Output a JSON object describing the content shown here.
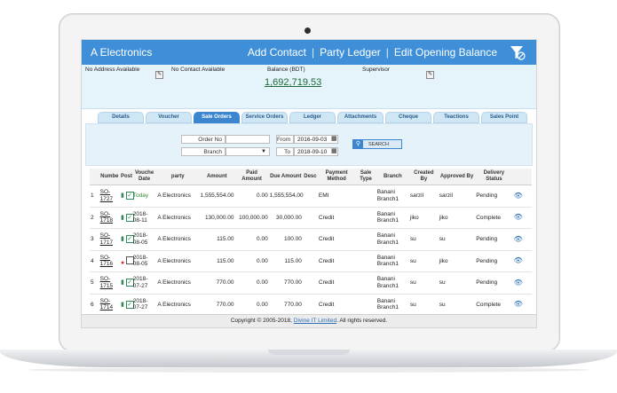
{
  "app": {
    "title": "A Electronics"
  },
  "top_actions": {
    "add_contact": "Add Contact",
    "party_ledger": "Party Ledger",
    "edit_opening_balance": "Edit Opening Balance",
    "sep": "|"
  },
  "info": {
    "address": "No Address Available",
    "contact": "No Contact Available",
    "balance_label": "Balance (BDT)",
    "balance_value": "1,692,719.53",
    "supervisor_label": "Supervisor"
  },
  "tabs": [
    "Details",
    "Voucher",
    "Sale Orders",
    "Service Orders",
    "Ledger",
    "Attachments",
    "Cheque",
    "Teactions",
    "Sales Point"
  ],
  "filters": {
    "order_no_label": "Order No",
    "branch_label": "Branch",
    "from_label": "From",
    "from_value": "2016-09-03",
    "to_label": "To",
    "to_value": "2018-09-10",
    "search_label": "SEARCH"
  },
  "table": {
    "headers": [
      "",
      "Numbe",
      "Post",
      "Vouche Date",
      "party",
      "Amount",
      "Paid Amount",
      "Due Amount",
      "Desc",
      "Payment Method",
      "Sale Type",
      "Branch",
      "Created By",
      "Approved By",
      "Delivery Status",
      ""
    ],
    "rows": [
      {
        "idx": "1",
        "no": "SO-1727",
        "post": "green",
        "checked": true,
        "date": "Today",
        "party": "A Electronics",
        "amount": "1,555,554.00",
        "paid": "0.00",
        "due": "1,555,554.00",
        "desc": "",
        "method": "EMI",
        "sale_type": "",
        "branch": "Banani Branch1",
        "created": "sarzil",
        "approved": "sarzil",
        "status": "Pending"
      },
      {
        "idx": "2",
        "no": "SO-1718",
        "post": "green",
        "checked": true,
        "date": "2018-08-11",
        "party": "A Electronics",
        "amount": "130,000.00",
        "paid": "100,000.00",
        "due": "30,000.00",
        "desc": "",
        "method": "Credit",
        "sale_type": "",
        "branch": "Banani Branch1",
        "created": "jiko",
        "approved": "jiko",
        "status": "Complete"
      },
      {
        "idx": "3",
        "no": "SO-1717",
        "post": "green",
        "checked": true,
        "date": "2018-08-05",
        "party": "A Electronics",
        "amount": "115.00",
        "paid": "0.00",
        "due": "100.00",
        "desc": "",
        "method": "Credit",
        "sale_type": "",
        "branch": "Banani Branch1",
        "created": "su",
        "approved": "su",
        "status": "Pending"
      },
      {
        "idx": "4",
        "no": "SO-1716",
        "post": "red",
        "checked": false,
        "date": "2018-08-05",
        "party": "A Electronics",
        "amount": "115.00",
        "paid": "0.00",
        "due": "115.00",
        "desc": "",
        "method": "Credit",
        "sale_type": "",
        "branch": "Banani Branch1",
        "created": "su",
        "approved": "jiko",
        "status": "Pending"
      },
      {
        "idx": "5",
        "no": "SO-1715",
        "post": "green",
        "checked": true,
        "date": "2018-07-27",
        "party": "A Electronics",
        "amount": "770.00",
        "paid": "0.00",
        "due": "770.00",
        "desc": "",
        "method": "Credit",
        "sale_type": "",
        "branch": "Banani Branch1",
        "created": "su",
        "approved": "su",
        "status": "Pending"
      },
      {
        "idx": "6",
        "no": "SO-1714",
        "post": "green",
        "checked": true,
        "date": "2018-07-27",
        "party": "A Electronics",
        "amount": "770.00",
        "paid": "0.00",
        "due": "770.00",
        "desc": "",
        "method": "Credit",
        "sale_type": "",
        "branch": "Banani Branch1",
        "created": "su",
        "approved": "su",
        "status": "Complete"
      }
    ]
  },
  "footer": {
    "prefix": "Copyright © 2005-2018,",
    "link": "Divine IT Limited",
    "suffix": ". All rights reserved."
  },
  "colors": {
    "accent": "#3f8fd8",
    "info_bg": "#e5f3fb",
    "balance": "#1d6a35",
    "today": "#2f8a2f"
  }
}
